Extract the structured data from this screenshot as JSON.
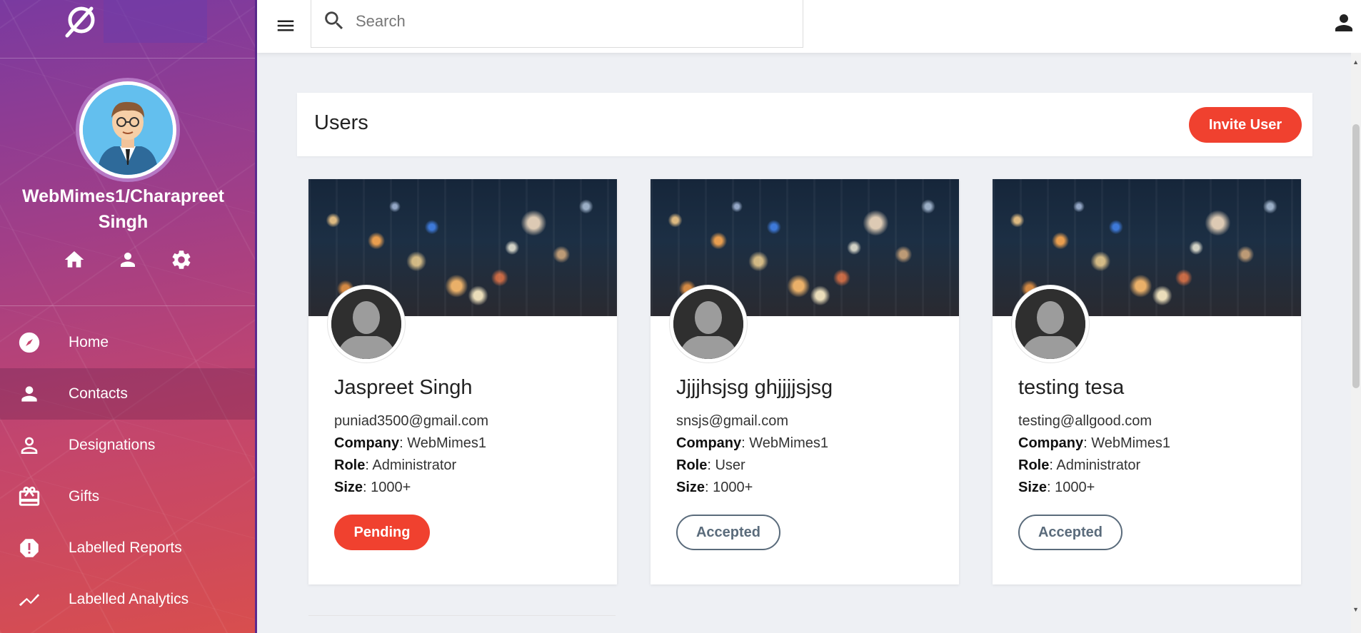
{
  "search": {
    "placeholder": "Search",
    "value": ""
  },
  "profile": {
    "name": "WebMimes1/Charapreet Singh"
  },
  "sidebar": {
    "items": [
      {
        "label": "Home",
        "icon": "compass-icon",
        "active": false
      },
      {
        "label": "Contacts",
        "icon": "person-icon",
        "active": true
      },
      {
        "label": "Designations",
        "icon": "person-outline-icon",
        "active": false
      },
      {
        "label": "Gifts",
        "icon": "gift-card-icon",
        "active": false
      },
      {
        "label": "Labelled Reports",
        "icon": "alert-octagon-icon",
        "active": false
      },
      {
        "label": "Labelled Analytics",
        "icon": "trending-icon",
        "active": false
      }
    ]
  },
  "page": {
    "title": "Users",
    "invite_label": "Invite User"
  },
  "labels": {
    "company": "Company",
    "role": "Role",
    "size": "Size",
    "sep": ": "
  },
  "users": [
    {
      "name": "Jaspreet Singh",
      "email": "puniad3500@gmail.com",
      "company": "WebMimes1",
      "role": "Administrator",
      "size": "1000+",
      "status": "Pending"
    },
    {
      "name": "Jjjjhsjsg ghjjjjsjsg",
      "email": "snsjs@gmail.com",
      "company": "WebMimes1",
      "role": "User",
      "size": "1000+",
      "status": "Accepted"
    },
    {
      "name": "testing tesa",
      "email": "testing@allgood.com",
      "company": "WebMimes1",
      "role": "Administrator",
      "size": "1000+",
      "status": "Accepted"
    }
  ],
  "colors": {
    "accent": "#f0412f",
    "accepted": "#5a6b7b",
    "sidebar_top": "#7a3aa0",
    "sidebar_bottom": "#d84e4e"
  }
}
